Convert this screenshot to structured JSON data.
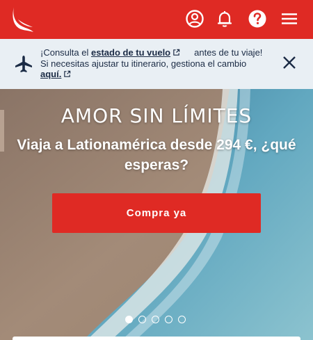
{
  "header": {
    "logo_icon": "bird-logo-icon",
    "icons": [
      "user-account-icon",
      "bell-notifications-icon",
      "help-question-icon",
      "hamburger-menu-icon"
    ],
    "brand_color": "#df2a24"
  },
  "notice": {
    "icon": "airplane-icon",
    "line1_prefix": "¡Consulta el ",
    "line1_link": "estado de tu vuelo",
    "line1_suffix": "antes de tu viaje!",
    "line2_text": "Si necesitas ajustar tu itinerario, gestiona el cambio",
    "line2_link": "aquí.",
    "close_icon": "close-icon"
  },
  "hero": {
    "title": "AMOR SIN LÍMITES",
    "subtitle": "Viaja a Lationamérica desde 294 €, ¿qué esperas?",
    "cta_label": "Compra ya",
    "slides_total": 5,
    "active_slide": 1
  }
}
